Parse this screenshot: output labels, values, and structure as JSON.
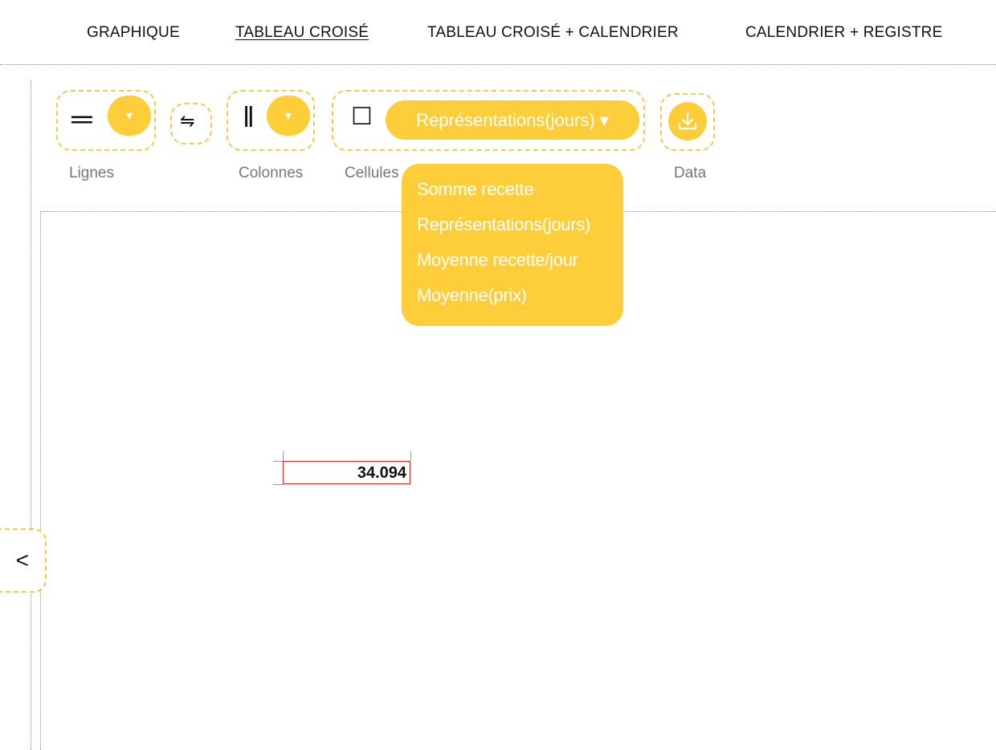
{
  "nav": {
    "tabs": [
      {
        "label": "GRAPHIQUE",
        "active": false
      },
      {
        "label": "TABLEAU CROISÉ",
        "active": true
      },
      {
        "label": "TABLEAU CROISÉ + CALENDRIER",
        "active": false
      },
      {
        "label": "CALENDRIER + REGISTRE",
        "active": false
      }
    ]
  },
  "toolbar": {
    "rows_label": "Lignes",
    "columns_label": "Colonnes",
    "cells_label": "Cellules",
    "data_label": "Data",
    "rows_glyph": "═",
    "swap_glyph": "⇋",
    "columns_glyph": "‖",
    "cells_glyph": "☐",
    "dropdown_arrow": "▾",
    "aggregator_selected": "Représentations(jours) ▾"
  },
  "aggregator_menu": {
    "options": [
      "Somme recette",
      "Représentations(jours)",
      "Moyenne recette/jour",
      "Moyenne(prix)"
    ]
  },
  "table": {
    "total_value": "34.094"
  },
  "sidebar_toggle": {
    "label": "<"
  },
  "colors": {
    "accent": "#fdce3a",
    "cell_border": "#cc2a2a"
  }
}
